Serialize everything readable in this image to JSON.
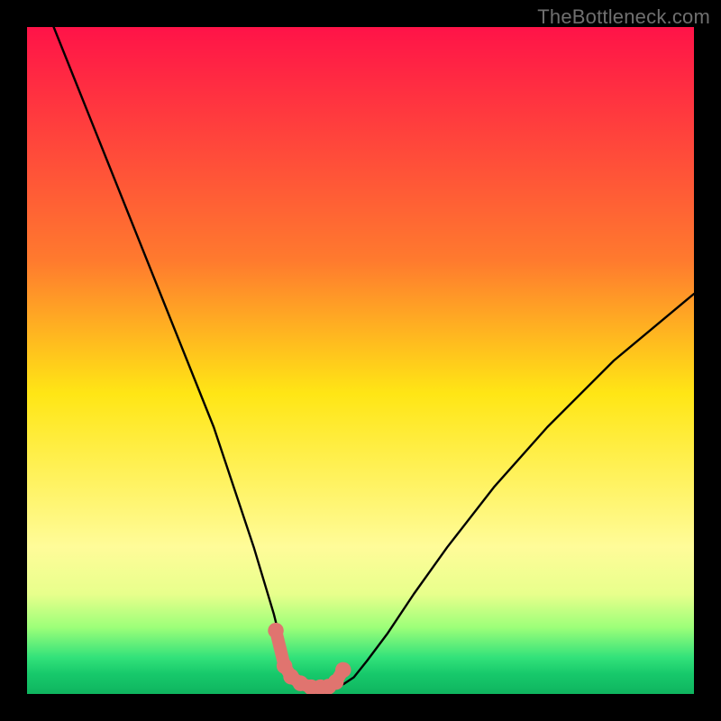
{
  "watermark": "TheBottleneck.com",
  "chart_data": {
    "type": "line",
    "title": "",
    "xlabel": "",
    "ylabel": "",
    "xlim": [
      0,
      100
    ],
    "ylim": [
      0,
      100
    ],
    "grid": false,
    "legend": false,
    "background_gradient_stops": [
      {
        "offset": 0.0,
        "color": "#ff1348"
      },
      {
        "offset": 0.35,
        "color": "#ff7a2e"
      },
      {
        "offset": 0.55,
        "color": "#ffe615"
      },
      {
        "offset": 0.78,
        "color": "#fffc99"
      },
      {
        "offset": 0.85,
        "color": "#e8ff8c"
      },
      {
        "offset": 0.9,
        "color": "#9dff79"
      },
      {
        "offset": 0.945,
        "color": "#33e27a"
      },
      {
        "offset": 0.97,
        "color": "#17c96b"
      },
      {
        "offset": 1.0,
        "color": "#0fb45f"
      }
    ],
    "series": [
      {
        "name": "bottleneck-curve",
        "stroke": "#000000",
        "stroke_width": 2.4,
        "x": [
          4,
          8,
          12,
          16,
          20,
          24,
          28,
          30,
          32,
          34,
          35.5,
          37,
          38,
          38.6,
          39.2,
          40,
          41.5,
          43,
          44.5,
          45.8,
          46.5,
          47.5,
          49,
          51,
          54,
          58,
          63,
          70,
          78,
          88,
          100
        ],
        "y": [
          100,
          90,
          80,
          70,
          60,
          50,
          40,
          34,
          28,
          22,
          17,
          12,
          8,
          5.5,
          4,
          2.8,
          1.8,
          1.2,
          1.0,
          1.0,
          1.1,
          1.5,
          2.5,
          5,
          9,
          15,
          22,
          31,
          40,
          50,
          60
        ]
      },
      {
        "name": "marker-dots",
        "stroke": "#e0746f",
        "fill": "#e0746f",
        "stroke_width": 14,
        "type_hint": "scatter",
        "x": [
          37.3,
          38.6,
          39.6,
          41.0,
          42.6,
          44.0,
          45.2,
          46.3,
          47.4
        ],
        "y": [
          9.5,
          4.2,
          2.6,
          1.6,
          1.0,
          1.0,
          1.1,
          1.8,
          3.6
        ]
      }
    ]
  }
}
